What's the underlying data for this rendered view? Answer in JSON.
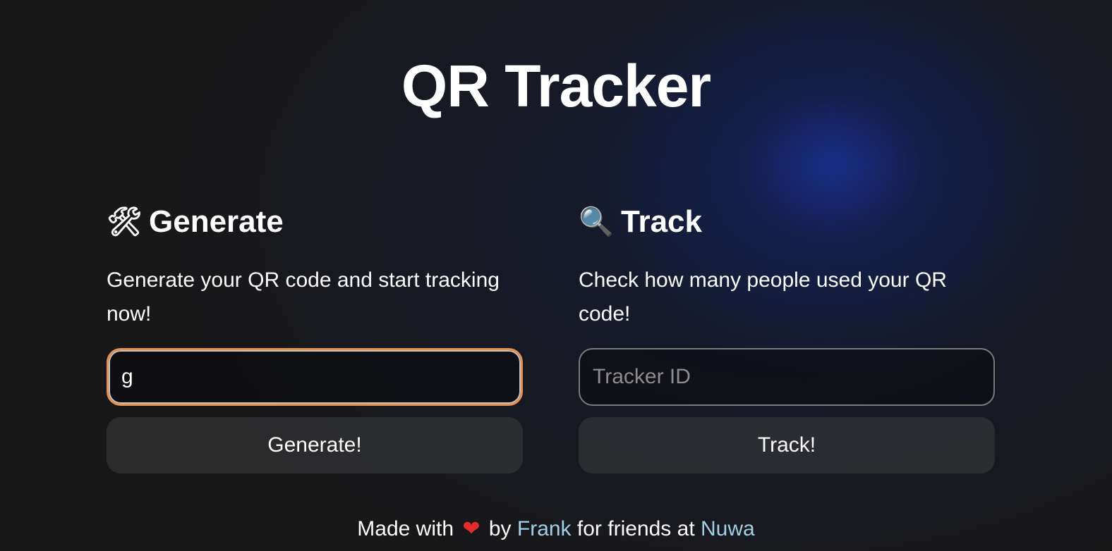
{
  "app": {
    "title": "QR Tracker"
  },
  "generate": {
    "icon": "hammer-and-wrench-icon",
    "icon_glyph": "🛠",
    "heading": "Generate",
    "description": "Generate your QR code and start tracking now!",
    "input_value": "g",
    "input_placeholder": "",
    "button_label": "Generate!"
  },
  "track": {
    "icon": "magnifying-glass-icon",
    "icon_glyph": "🔍",
    "heading": "Track",
    "description": "Check how many people used your QR code!",
    "input_value": "",
    "input_placeholder": "Tracker ID",
    "button_label": "Track!"
  },
  "footer": {
    "prefix": "Made with",
    "heart_glyph": "❤",
    "by_text": "by",
    "author": "Frank",
    "middle_text": "for friends at",
    "org": "Nuwa"
  },
  "colors": {
    "background": "#181818",
    "glow": "#1830a0",
    "focus_border": "#e8914a",
    "link": "#9fd0e6",
    "heart": "#e52b2b"
  }
}
